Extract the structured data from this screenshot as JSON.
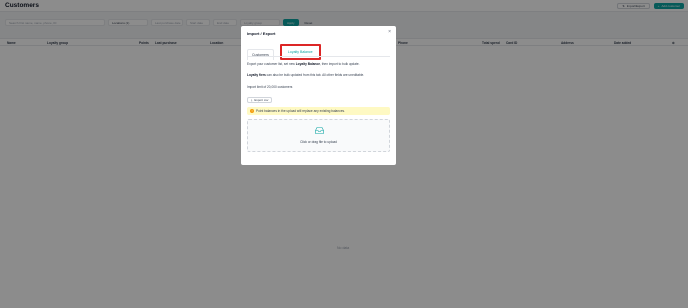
{
  "page": {
    "title": "Customers",
    "import_export_label": "Import/Export",
    "add_customer_label": "Add customer"
  },
  "filters": {
    "search_placeholder": "Search first name, name, phone, ID",
    "location_value": "Locations (1)",
    "date_from_placeholder": "Last purchase date",
    "date_to_placeholder": "Start date",
    "date_end_placeholder": "End date",
    "loyalty_placeholder": "Loyalty group",
    "apply_label": "Apply",
    "reset_label": "Reset"
  },
  "table": {
    "columns": [
      "Name",
      "Loyalty group",
      "Points",
      "Last purchase",
      "Location",
      "Phone",
      "Total spend",
      "Card ID",
      "Address",
      "Date added"
    ],
    "empty_text": "No data"
  },
  "modal": {
    "title": "Import / Export",
    "tabs": [
      {
        "label": "Customers",
        "active": false
      },
      {
        "label": "Loyalty Balance",
        "active": true
      }
    ],
    "intro_pre": "Export your customer list, set new ",
    "intro_bold": "Loyalty Balance",
    "intro_post": ", then import to bulk update.",
    "fields_bold": "Loyalty fiers",
    "fields_post": " can also be bulk updated from this tab. All other fields are uneditable.",
    "limit_text": "Import limit of 20,000 customers",
    "export_label": "Export csv",
    "warning_text": "Point balances in the upload will replace any existing balances.",
    "upload_text": "Click or drag file to upload"
  },
  "colors": {
    "accent": "#0ea5a3",
    "highlight_border": "#dc2626",
    "warning_bg": "#fef9c3"
  }
}
